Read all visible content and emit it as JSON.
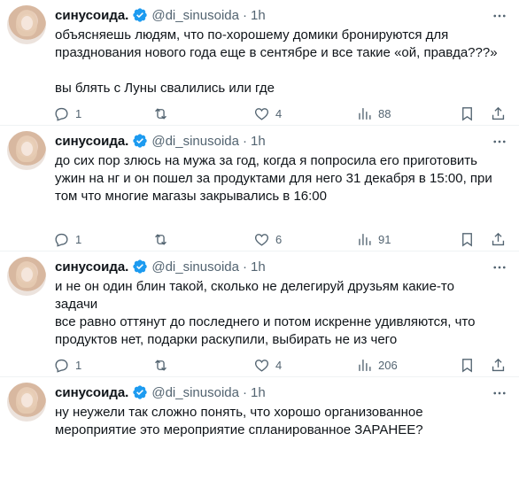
{
  "accent_color": "#1d9bf0",
  "author": {
    "name": "синусоида.",
    "handle": "@di_sinusoida",
    "separator": "·",
    "verified": true
  },
  "tweets": [
    {
      "time": "1h",
      "text": "объясняешь людям, что по-хорошему домики бронируются для\nпразднования нового года еще в сентябре и все такие «ой, правда???»\n\nвы блять с Луны свалились или где",
      "replies": "1",
      "retweets": "",
      "likes": "4",
      "views": "88"
    },
    {
      "time": "1h",
      "text": "до сих пор злюсь на мужа за год, когда я попросила его приготовить\nужин на нг и он пошел за продуктами для него 31 декабря в 15:00, при\nтом что многие магазы закрывались в 16:00",
      "replies": "1",
      "retweets": "",
      "likes": "6",
      "views": "91"
    },
    {
      "time": "1h",
      "text": "и не он один блин такой, сколько не делегируй друзьям какие-то задачи\nвсе равно оттянут до последнего и потом искренне удивляются, что\nпродуктов нет, подарки раскупили, выбирать не из чего",
      "replies": "1",
      "retweets": "",
      "likes": "4",
      "views": "206"
    },
    {
      "time": "1h",
      "text": "ну неужели так сложно понять, что хорошо организованное\nмероприятие это мероприятие спланированное ЗАРАНЕЕ?"
    }
  ]
}
